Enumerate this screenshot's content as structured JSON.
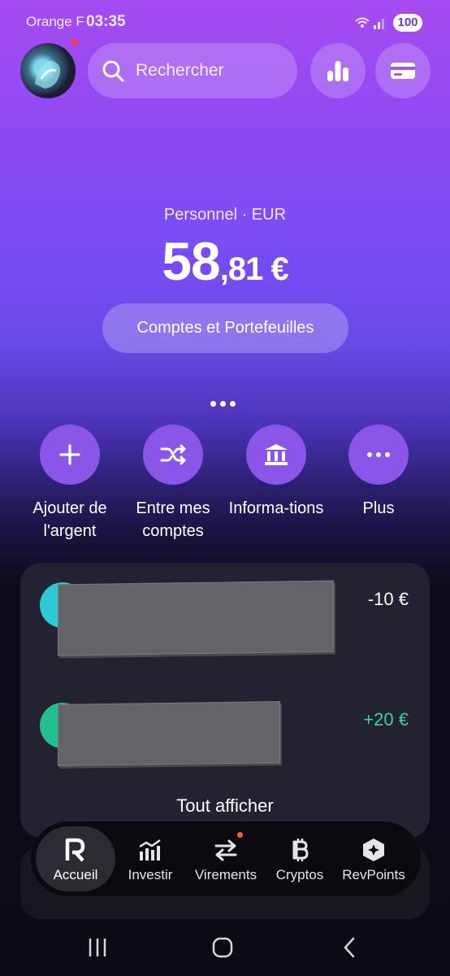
{
  "status_bar": {
    "carrier": "Orange F",
    "time": "03:35",
    "battery": "100"
  },
  "header": {
    "search_placeholder": "Rechercher"
  },
  "account": {
    "label": "Personnel · EUR",
    "balance_int": "58",
    "balance_dec": ",81 €",
    "accounts_button": "Comptes et Portefeuilles"
  },
  "actions": [
    {
      "label": "Ajouter de l'argent",
      "icon": "plus-icon"
    },
    {
      "label": "Entre mes comptes",
      "icon": "shuffle-icon"
    },
    {
      "label": "Informa-tions",
      "icon": "bank-icon"
    },
    {
      "label": "Plus",
      "icon": "more-icon"
    }
  ],
  "transactions": {
    "items": [
      {
        "amount": "-10 €",
        "amount_color": "#ffffff",
        "avatar_color": "#2cc9d6"
      },
      {
        "amount": "+20 €",
        "amount_color": "#3fd0a8",
        "avatar_color": "#21c08f"
      }
    ],
    "show_all": "Tout afficher"
  },
  "nav": {
    "items": [
      {
        "label": "Accueil",
        "icon": "revolut-r-icon",
        "active": true
      },
      {
        "label": "Investir",
        "icon": "chart-bars-icon"
      },
      {
        "label": "Virements",
        "icon": "transfer-arrows-icon"
      },
      {
        "label": "Cryptos",
        "icon": "bitcoin-icon"
      },
      {
        "label": "RevPoints",
        "icon": "revpoints-hexagon-icon"
      }
    ]
  },
  "colors": {
    "accent": "#8b55ea",
    "positive": "#3fd0a8",
    "notification": "#ff3b3b"
  }
}
